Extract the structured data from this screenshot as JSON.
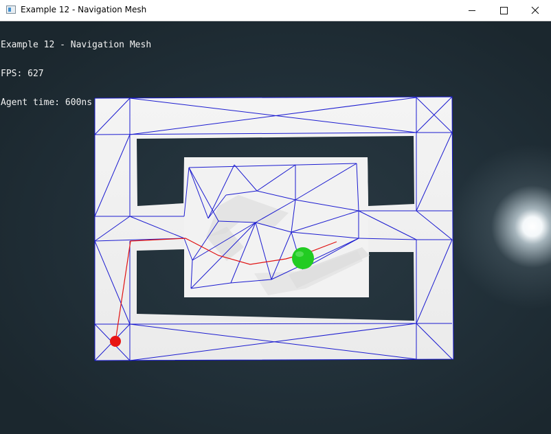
{
  "window": {
    "title": "Example 12 - Navigation Mesh",
    "controls": [
      "minimize",
      "maximize",
      "close"
    ]
  },
  "hud": {
    "title_line": "Example 12 - Navigation Mesh",
    "fps_line": "FPS: 627",
    "agent_time_line": "Agent time: 600ns"
  },
  "colors": {
    "navmesh_edges": "#1a1ad0",
    "path": "#e01010",
    "agent": "#2ad02a",
    "target": "#e81414",
    "floor": "#f0f0f0",
    "background": "#1e2a31"
  },
  "icons": {
    "app": "window-app-icon",
    "minimize": "minimize-icon",
    "maximize": "maximize-icon",
    "close": "close-icon"
  }
}
